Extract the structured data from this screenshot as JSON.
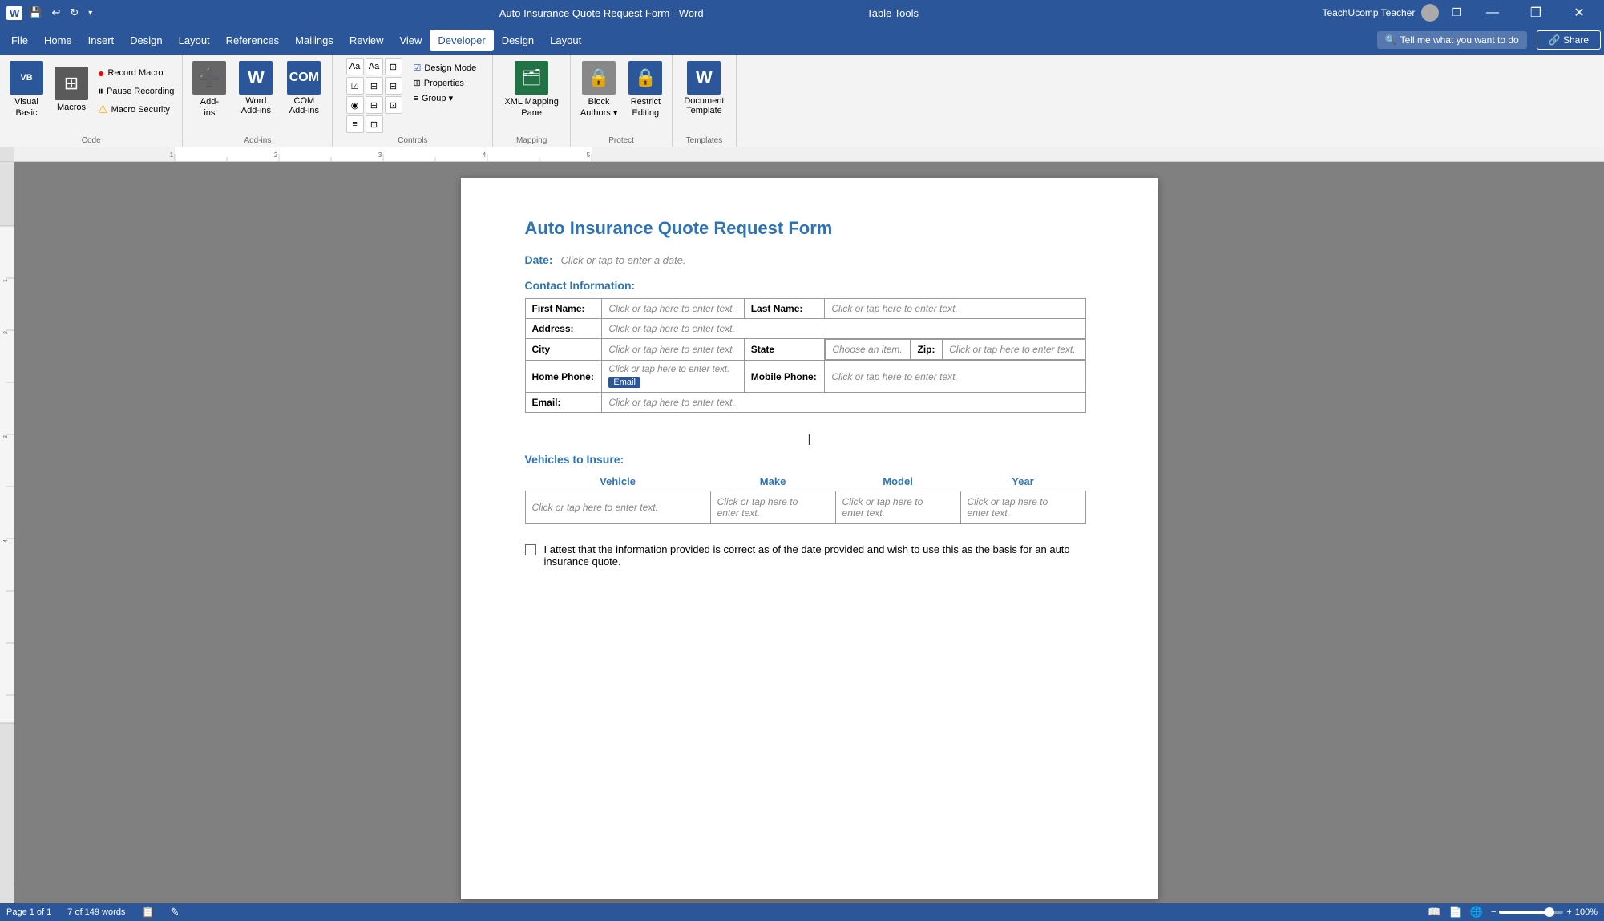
{
  "titlebar": {
    "title": "Auto Insurance Quote Request Form - Word",
    "table_tools": "Table Tools",
    "user": "TeachUcomp Teacher",
    "save_icon": "💾",
    "undo_icon": "↩",
    "redo_icon": "↻",
    "minimize": "—",
    "restore": "❐",
    "close": "✕"
  },
  "menubar": {
    "items": [
      "File",
      "Home",
      "Insert",
      "Design",
      "Layout",
      "References",
      "Mailings",
      "Review",
      "View",
      "Developer",
      "Design",
      "Layout"
    ],
    "active": "Developer",
    "search_placeholder": "Tell me what you want to do",
    "share": "Share"
  },
  "ribbon": {
    "groups": [
      {
        "name": "Code",
        "label": "Code",
        "items": [
          {
            "type": "big",
            "label": "Visual\nBasic",
            "icon": "VB"
          },
          {
            "type": "big",
            "label": "Macros",
            "icon": "⊞"
          },
          {
            "type": "small",
            "label": "Record Macro",
            "icon": "●"
          },
          {
            "type": "small",
            "label": "Pause Recording",
            "icon": "⏸"
          },
          {
            "type": "small",
            "label": "Macro Security",
            "icon": "⚠"
          }
        ]
      },
      {
        "name": "Add-ins",
        "label": "Add-ins",
        "items": [
          {
            "type": "big",
            "label": "Add-\nins",
            "icon": "➕"
          },
          {
            "type": "big",
            "label": "Word\nAdd-ins",
            "icon": "W"
          },
          {
            "type": "big",
            "label": "COM\nAdd-ins",
            "icon": "C"
          }
        ]
      },
      {
        "name": "Controls",
        "label": "Controls",
        "items": [
          {
            "label": "Aa",
            "type": "ctrl"
          },
          {
            "label": "Aa",
            "type": "ctrl"
          },
          {
            "label": "⊡",
            "type": "ctrl"
          },
          {
            "label": "☑",
            "type": "ctrl"
          },
          {
            "label": "⊞",
            "type": "ctrl"
          },
          {
            "label": "⊟",
            "type": "ctrl"
          },
          {
            "label": "◉",
            "type": "ctrl"
          },
          {
            "label": "⊞",
            "type": "ctrl"
          },
          {
            "label": "⊡",
            "type": "ctrl"
          },
          {
            "label": "≡",
            "type": "ctrl"
          },
          {
            "label": "⊡",
            "type": "ctrl"
          }
        ],
        "extras": [
          "Design Mode",
          "Properties",
          "Group ▾"
        ]
      },
      {
        "name": "Mapping",
        "label": "Mapping",
        "items": [
          {
            "label": "XML Mapping\nPane",
            "icon": "🗂"
          }
        ]
      },
      {
        "name": "Protect",
        "label": "Protect",
        "items": [
          {
            "type": "big",
            "label": "Block\nAuthors",
            "icon": "🔒"
          },
          {
            "type": "big",
            "label": "Restrict\nEditing",
            "icon": "🔒"
          }
        ]
      },
      {
        "name": "Templates",
        "label": "Templates",
        "items": [
          {
            "type": "big",
            "label": "Document\nTemplate",
            "icon": "W"
          }
        ]
      }
    ]
  },
  "document": {
    "title": "Auto Insurance Quote Request Form",
    "date_label": "Date:",
    "date_value": "Click or tap to enter a date.",
    "contact_section": "Contact Information:",
    "fields": {
      "first_name_label": "First Name:",
      "first_name_value": "Click or tap here to enter text.",
      "last_name_label": "Last Name:",
      "last_name_value": "Click or tap here to enter text.",
      "address_label": "Address:",
      "address_value": "Click or tap here to enter text.",
      "city_label": "City",
      "city_value": "Click or tap here to enter text.",
      "state_label": "State",
      "state_value": "Choose an item.",
      "zip_label": "Zip:",
      "zip_value": "Click or tap here to enter text.",
      "home_phone_label": "Home Phone:",
      "home_phone_value": "Click or tap here to enter text.",
      "mobile_phone_label": "Mobile Phone:",
      "mobile_phone_value": "Click or tap here to enter text.",
      "email_label": "Email:",
      "email_tag": "Email",
      "email_value": "Click or tap here to enter text."
    },
    "vehicles_section": "Vehicles to Insure:",
    "vehicle_headers": [
      "Vehicle",
      "Make",
      "Model",
      "Year"
    ],
    "vehicle_row": [
      "Click or tap here to enter text.",
      "Click or tap here to enter text.",
      "Click or tap here to enter text.",
      "Click or tap here to enter text."
    ],
    "attestation": "I attest that the information provided is correct as of the date provided and wish to use this as the basis for an auto insurance quote."
  },
  "statusbar": {
    "page": "Page 1 of 1",
    "words": "7 of 149 words",
    "zoom": "100%"
  }
}
